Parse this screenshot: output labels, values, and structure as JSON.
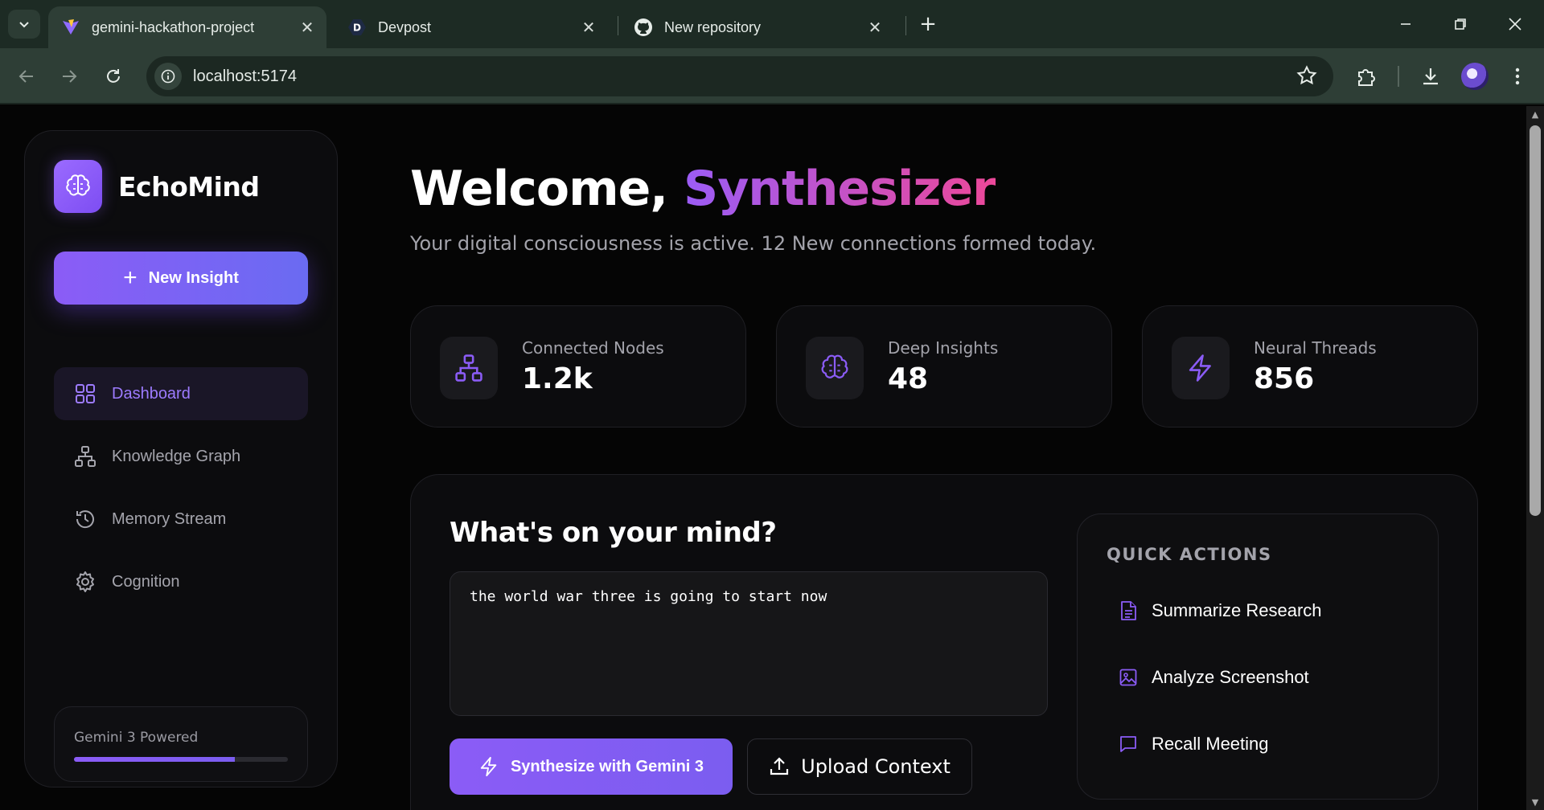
{
  "browser": {
    "tabs": [
      {
        "title": "gemini-hackathon-project",
        "active": true,
        "favicon": "vite-icon"
      },
      {
        "title": "Devpost",
        "active": false,
        "favicon": "devpost-icon",
        "favicon_letter": "D"
      },
      {
        "title": "New repository",
        "active": false,
        "favicon": "github-icon"
      }
    ],
    "url": "localhost:5174"
  },
  "sidebar": {
    "brand": "EchoMind",
    "new_insight_label": "New Insight",
    "items": [
      {
        "label": "Dashboard",
        "icon": "grid-icon",
        "active": true
      },
      {
        "label": "Knowledge Graph",
        "icon": "network-icon",
        "active": false
      },
      {
        "label": "Memory Stream",
        "icon": "history-icon",
        "active": false
      },
      {
        "label": "Cognition",
        "icon": "gear-icon",
        "active": false
      }
    ],
    "powered": {
      "label": "Gemini 3 Powered",
      "progress": 0.75
    }
  },
  "main": {
    "welcome_prefix": "Welcome, ",
    "welcome_name": "Synthesizer",
    "subtitle": "Your digital consciousness is active. 12 New connections formed today.",
    "stats": [
      {
        "label": "Connected Nodes",
        "value": "1.2k",
        "icon": "network-icon"
      },
      {
        "label": "Deep Insights",
        "value": "48",
        "icon": "brain-icon"
      },
      {
        "label": "Neural Threads",
        "value": "856",
        "icon": "zap-icon"
      }
    ],
    "composer": {
      "title": "What's on your mind?",
      "input_value": "the world war three is going to start now",
      "synth_label": "Synthesize with Gemini 3",
      "upload_label": "Upload Context"
    },
    "quick_actions": {
      "title": "QUICK ACTIONS",
      "items": [
        {
          "label": "Summarize Research",
          "icon": "document-icon"
        },
        {
          "label": "Analyze Screenshot",
          "icon": "image-icon"
        },
        {
          "label": "Recall Meeting",
          "icon": "message-icon"
        }
      ]
    }
  },
  "colors": {
    "accent": "#8b5cf6",
    "gradient_end": "#ec4899",
    "background": "#050505",
    "card": "#0c0c0e"
  }
}
